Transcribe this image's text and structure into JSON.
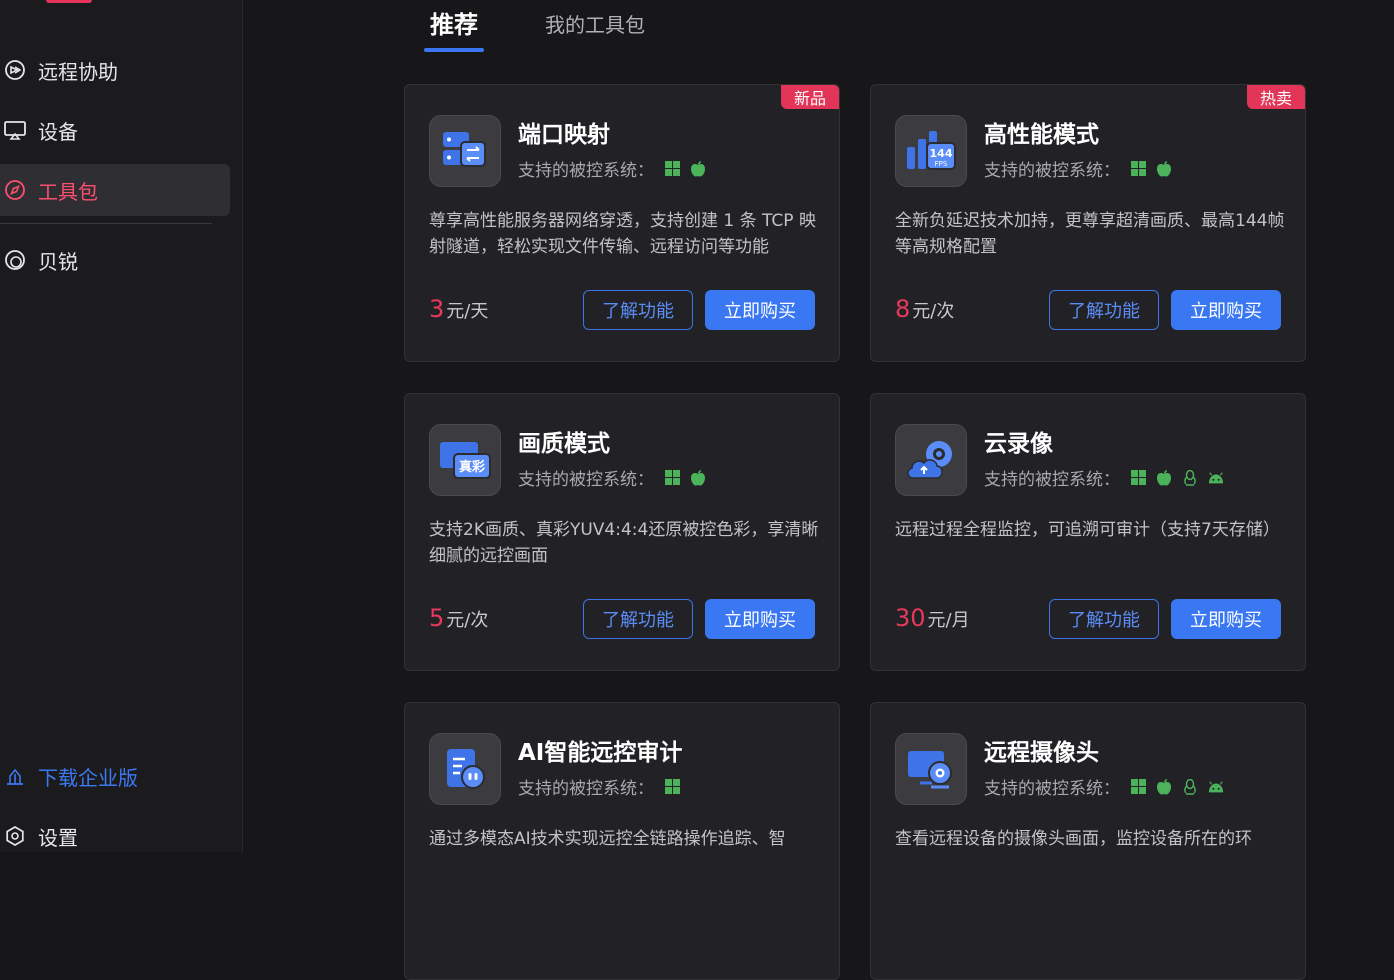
{
  "sidebar": {
    "items": [
      {
        "label": "远程协助",
        "icon": "remote-assist-icon"
      },
      {
        "label": "设备",
        "icon": "device-icon"
      },
      {
        "label": "工具包",
        "icon": "compass-icon",
        "active": true
      },
      {
        "label": "贝锐",
        "icon": "oray-icon"
      }
    ],
    "bottom": [
      {
        "label": "下载企业版",
        "icon": "enterprise-icon"
      },
      {
        "label": "设置",
        "icon": "gear-icon"
      }
    ]
  },
  "tabs": [
    {
      "label": "推荐",
      "active": true
    },
    {
      "label": "我的工具包",
      "active": false
    }
  ],
  "colors": {
    "accent": "#3a77f2",
    "badge": "#e33558",
    "price": "#e7395c",
    "active_nav": "#ff4f6e"
  },
  "cards": [
    {
      "title": "端口映射",
      "badge": "新品",
      "os_label": "支持的被控系统：",
      "os": [
        "windows",
        "apple"
      ],
      "desc": "尊享高性能服务器网络穿透，支持创建 1 条 TCP 映射隧道，轻松实现文件传输、远程访问等功能",
      "price": "3",
      "unit": "元/天",
      "learn": "了解功能",
      "buy": "立即购买"
    },
    {
      "title": "高性能模式",
      "badge": "热卖",
      "os_label": "支持的被控系统：",
      "os": [
        "windows",
        "apple"
      ],
      "icon_text": "144",
      "icon_sub": "FPS",
      "desc": "全新负延迟技术加持，更尊享超清画质、最高144帧等高规格配置",
      "price": "8",
      "unit": "元/次",
      "learn": "了解功能",
      "buy": "立即购买"
    },
    {
      "title": "画质模式",
      "os_label": "支持的被控系统：",
      "os": [
        "windows",
        "apple"
      ],
      "icon_text": "真彩",
      "desc": "支持2K画质、真彩YUV4:4:4还原被控色彩，享清晰细腻的远控画面",
      "price": "5",
      "unit": "元/次",
      "learn": "了解功能",
      "buy": "立即购买"
    },
    {
      "title": "云录像",
      "os_label": "支持的被控系统：",
      "os": [
        "windows",
        "apple",
        "linux",
        "android"
      ],
      "desc": "远程过程全程监控，可追溯可审计（支持7天存储）",
      "price": "30",
      "unit": "元/月",
      "learn": "了解功能",
      "buy": "立即购买"
    },
    {
      "title": "AI智能远控审计",
      "os_label": "支持的被控系统：",
      "os": [
        "windows"
      ],
      "desc": "通过多模态AI技术实现远控全链路操作追踪、智"
    },
    {
      "title": "远程摄像头",
      "os_label": "支持的被控系统：",
      "os": [
        "windows",
        "apple",
        "linux",
        "android"
      ],
      "desc": "查看远程设备的摄像头画面，监控设备所在的环"
    }
  ]
}
